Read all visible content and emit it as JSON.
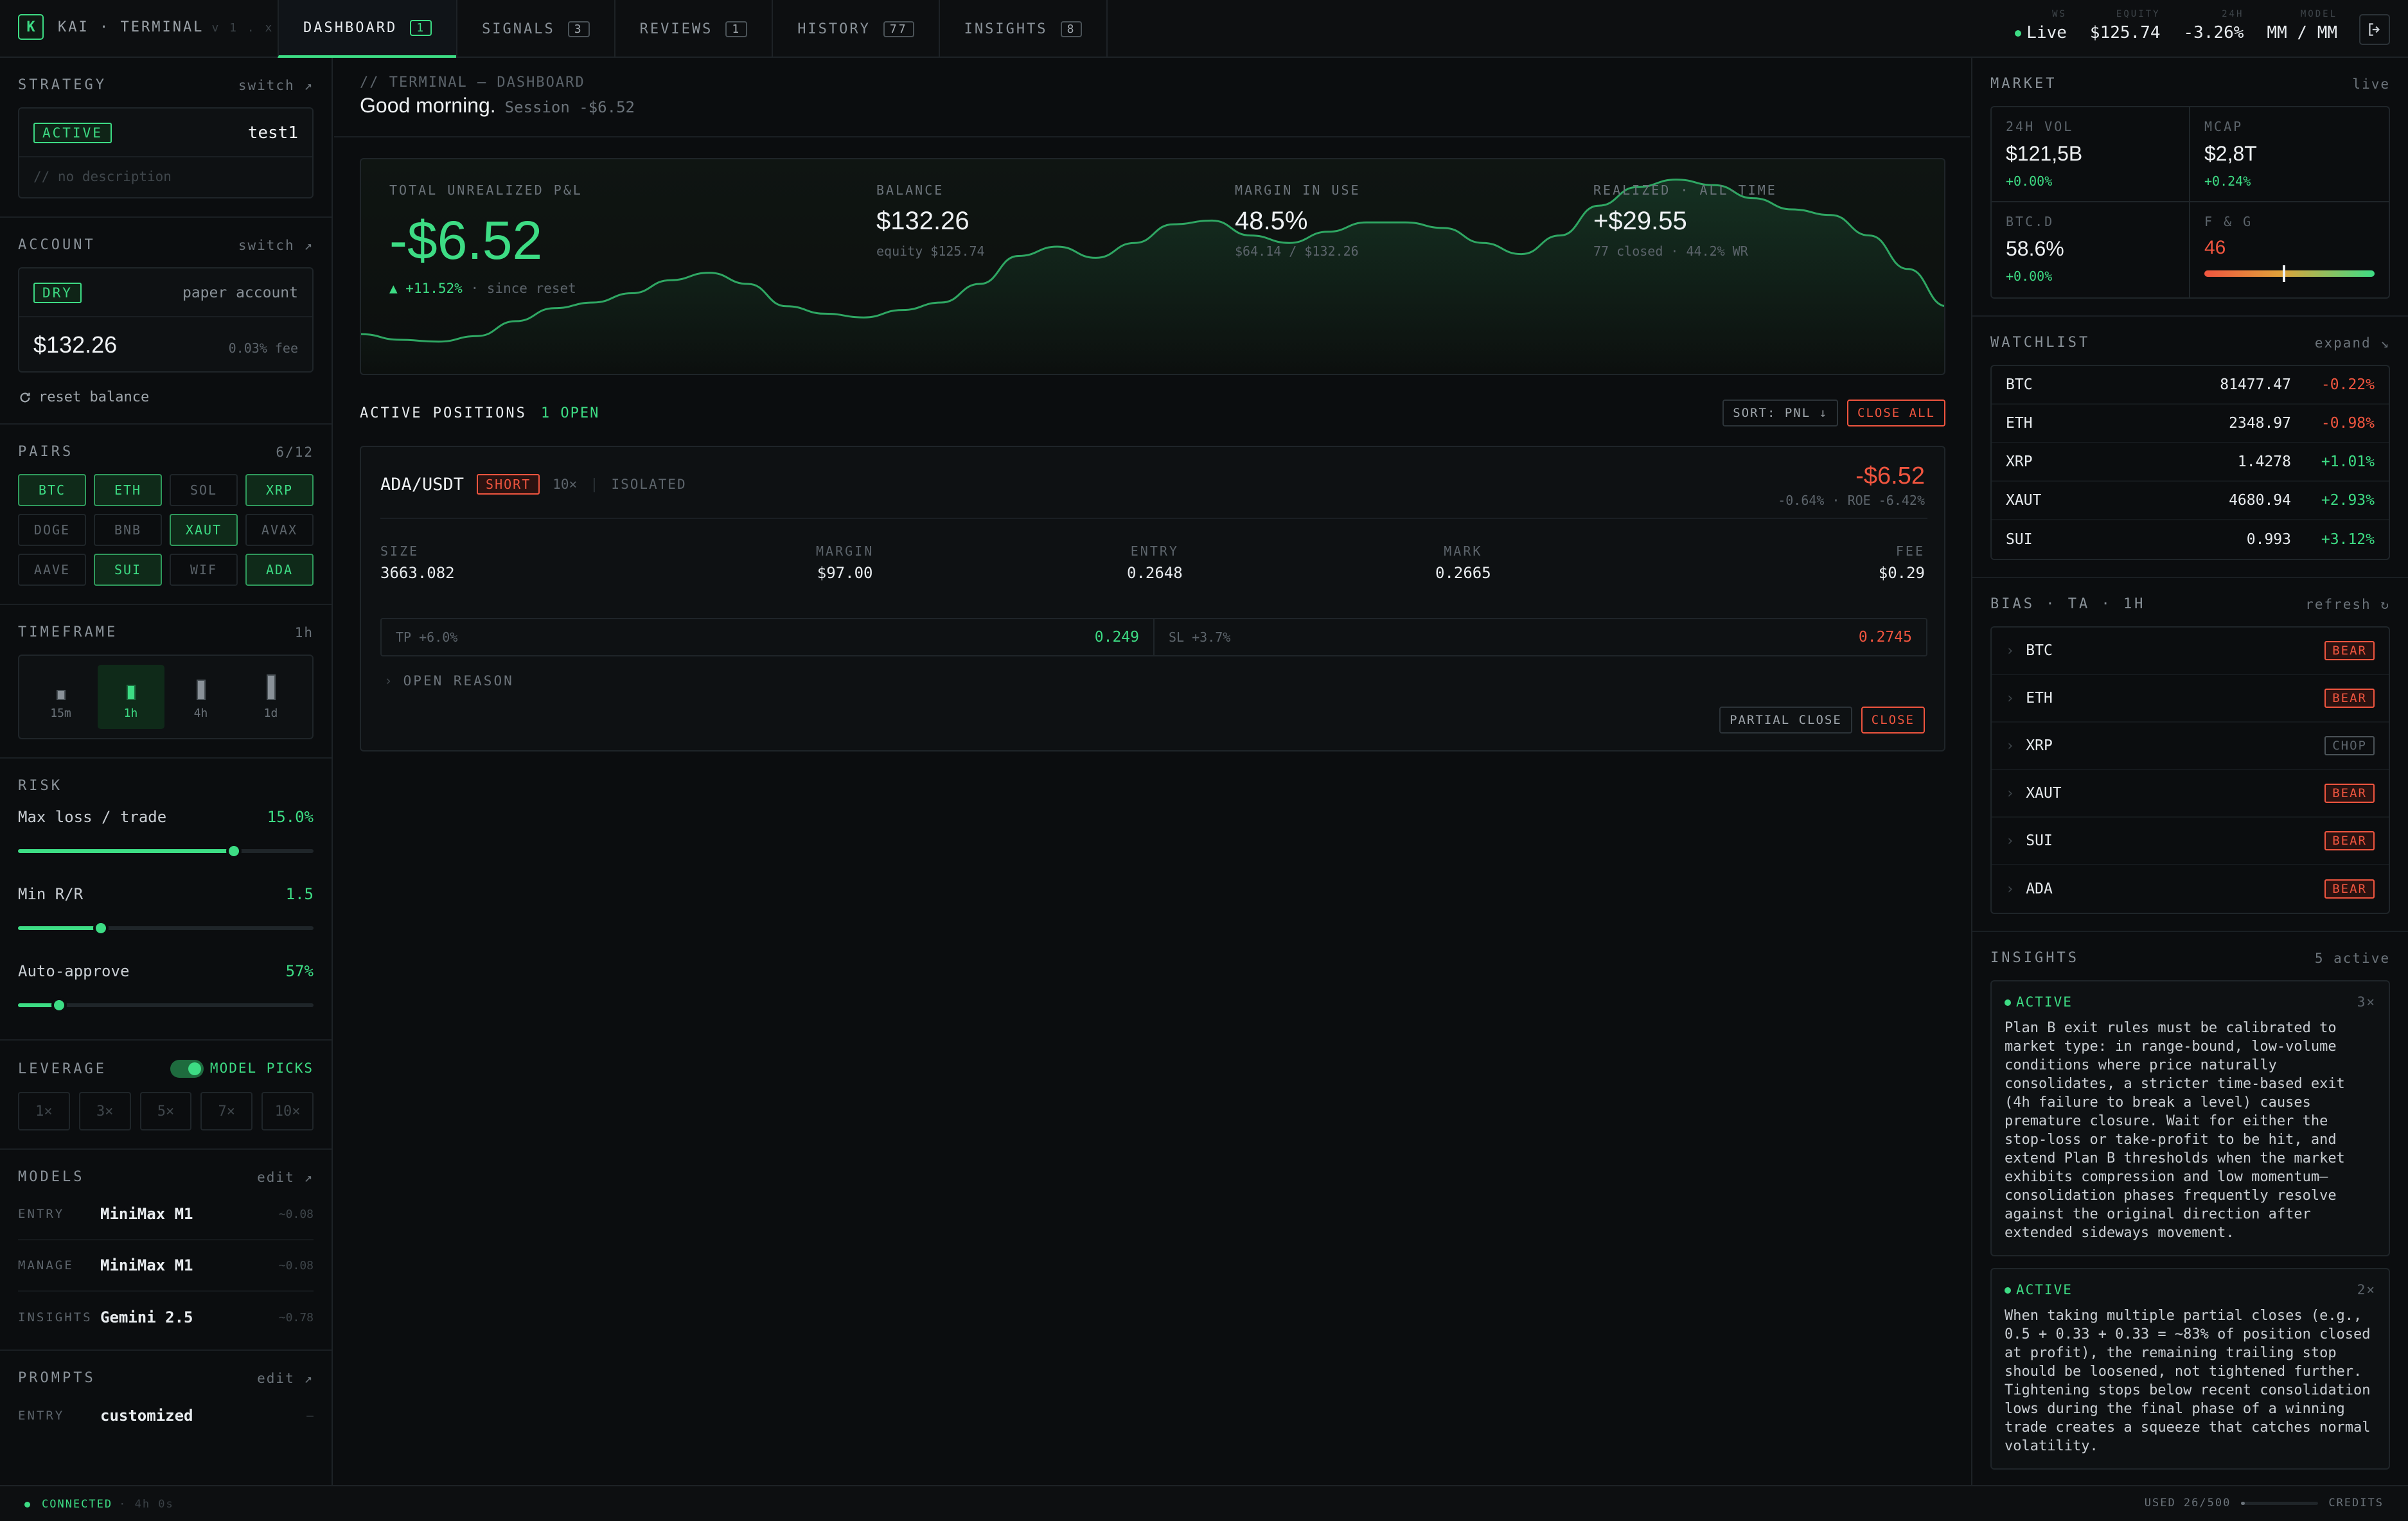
{
  "brand": {
    "logo": "K",
    "name": "KAI · TERMINAL",
    "version": "v 1 . x"
  },
  "tabs": [
    {
      "label": "DASHBOARD",
      "count": "1",
      "active": true
    },
    {
      "label": "SIGNALS",
      "count": "3"
    },
    {
      "label": "REVIEWS",
      "count": "1"
    },
    {
      "label": "HISTORY",
      "count": "77"
    },
    {
      "label": "INSIGHTS",
      "count": "8"
    }
  ],
  "topstats": {
    "ws_label": "WS",
    "ws_value": "Live",
    "equity_label": "EQUITY",
    "equity_value": "$125.74",
    "change_label": "24H",
    "change_value": "-3.26%",
    "model_label": "MODEL",
    "model_value": "MM / MM"
  },
  "strategy": {
    "title": "STRATEGY",
    "action": "switch ↗",
    "status": "ACTIVE",
    "name": "test1",
    "description": "// no description"
  },
  "account": {
    "title": "ACCOUNT",
    "action": "switch ↗",
    "mode": "DRY",
    "type": "paper account",
    "balance": "$132.26",
    "fee": "0.03% fee",
    "reset": "reset balance"
  },
  "pairs": {
    "title": "PAIRS",
    "count": "6/12",
    "items": [
      {
        "sym": "BTC",
        "on": true
      },
      {
        "sym": "ETH",
        "on": true
      },
      {
        "sym": "SOL",
        "on": false
      },
      {
        "sym": "XRP",
        "on": true
      },
      {
        "sym": "DOGE",
        "on": false
      },
      {
        "sym": "BNB",
        "on": false
      },
      {
        "sym": "XAUT",
        "on": true
      },
      {
        "sym": "AVAX",
        "on": false
      },
      {
        "sym": "AAVE",
        "on": false
      },
      {
        "sym": "SUI",
        "on": true
      },
      {
        "sym": "WIF",
        "on": false
      },
      {
        "sym": "ADA",
        "on": true
      }
    ]
  },
  "timeframe": {
    "title": "TIMEFRAME",
    "current": "1h",
    "options": [
      "15m",
      "1h",
      "4h",
      "1d"
    ],
    "selected": "1h"
  },
  "risk": {
    "title": "RISK",
    "rows": [
      {
        "label": "Max loss / trade",
        "value": "15.0%",
        "level": 0.73
      },
      {
        "label": "Min R/R",
        "value": "1.5",
        "level": 0.28
      },
      {
        "label": "Auto-approve",
        "value": "57%",
        "level": 0.14
      }
    ]
  },
  "leverage": {
    "title": "LEVERAGE",
    "toggle_label": "MODEL PICKS",
    "options": [
      "1×",
      "3×",
      "5×",
      "7×",
      "10×"
    ]
  },
  "models": {
    "title": "MODELS",
    "action": "edit ↗",
    "rows": [
      {
        "key": "ENTRY",
        "name": "MiniMax M1",
        "price": "~0.08"
      },
      {
        "key": "MANAGE",
        "name": "MiniMax M1",
        "price": "~0.08"
      },
      {
        "key": "INSIGHTS",
        "name": "Gemini 2.5",
        "price": "~0.78"
      }
    ]
  },
  "prompts": {
    "title": "PROMPTS",
    "action": "edit ↗",
    "rows": [
      {
        "key": "ENTRY",
        "value": "customized",
        "extra": "—"
      }
    ]
  },
  "main": {
    "crumb": "// TERMINAL — DASHBOARD",
    "greeting": "Good morning.",
    "session": "Session -$6.52"
  },
  "hero": {
    "pnl_label": "TOTAL UNREALIZED P&L",
    "pnl_value": "-$6.52",
    "pnl_change": "▲ +11.52%",
    "pnl_since": "· since reset",
    "balance_label": "BALANCE",
    "balance_value": "$132.26",
    "balance_sub": "equity $125.74",
    "margin_label": "MARGIN IN USE",
    "margin_value": "48.5%",
    "margin_sub": "$64.14 / $132.26",
    "realized_label": "REALIZED · ALL-TIME",
    "realized_value": "+$29.55",
    "realized_sub": "77 closed · 44.2% WR"
  },
  "equity_curve": [
    0.13,
    0.1,
    0.09,
    0.12,
    0.2,
    0.27,
    0.3,
    0.35,
    0.42,
    0.46,
    0.4,
    0.28,
    0.24,
    0.22,
    0.26,
    0.3,
    0.4,
    0.55,
    0.6,
    0.54,
    0.62,
    0.72,
    0.74,
    0.66,
    0.62,
    0.68,
    0.73,
    0.73,
    0.7,
    0.62,
    0.56,
    0.66,
    0.82,
    0.92,
    0.96,
    0.93,
    0.86,
    0.8,
    0.77,
    0.66,
    0.48,
    0.28
  ],
  "positions": {
    "title": "ACTIVE POSITIONS",
    "open": "1 OPEN",
    "sort": "SORT: PNL ↓",
    "close_all": "CLOSE ALL",
    "item": {
      "pair": "ADA/USDT",
      "side": "SHORT",
      "leverage": "10×",
      "margin_mode": "ISOLATED",
      "pnl": "-$6.52",
      "pnl_sub": "-0.64% · ROE -6.42%",
      "size_label": "SIZE",
      "size": "3663.082",
      "margin_label": "MARGIN",
      "margin": "$97.00",
      "entry_label": "ENTRY",
      "entry": "0.2648",
      "mark_label": "MARK",
      "mark": "0.2665",
      "fee_label": "FEE",
      "fee": "$0.29",
      "tp_label": "TP +6.0%",
      "tp": "0.249",
      "sl_label": "SL +3.7%",
      "sl": "0.2745",
      "reason": "OPEN REASON",
      "partial": "PARTIAL CLOSE",
      "close": "CLOSE"
    }
  },
  "market": {
    "title": "MARKET",
    "status": "live",
    "vol_label": "24H VOL",
    "vol": "$121,5B",
    "vol_change": "+0.00%",
    "mcap_label": "MCAP",
    "mcap": "$2,8T",
    "mcap_change": "+0.24%",
    "btcd_label": "BTC.D",
    "btcd": "58.6%",
    "btcd_change": "+0.00%",
    "fg_label": "F & G",
    "fg": "46",
    "fg_level": 0.46
  },
  "watchlist": {
    "title": "WATCHLIST",
    "action": "expand ↘",
    "rows": [
      {
        "sym": "BTC",
        "price": "81477.47",
        "change": "-0.22%",
        "dir": "down"
      },
      {
        "sym": "ETH",
        "price": "2348.97",
        "change": "-0.98%",
        "dir": "down"
      },
      {
        "sym": "XRP",
        "price": "1.4278",
        "change": "+1.01%",
        "dir": "up"
      },
      {
        "sym": "XAUT",
        "price": "4680.94",
        "change": "+2.93%",
        "dir": "up"
      },
      {
        "sym": "SUI",
        "price": "0.993",
        "change": "+3.12%",
        "dir": "up"
      }
    ]
  },
  "bias": {
    "title": "BIAS · TA · 1H",
    "action": "refresh",
    "rows": [
      {
        "sym": "BTC",
        "tag": "BEAR"
      },
      {
        "sym": "ETH",
        "tag": "BEAR"
      },
      {
        "sym": "XRP",
        "tag": "CHOP"
      },
      {
        "sym": "XAUT",
        "tag": "BEAR"
      },
      {
        "sym": "SUI",
        "tag": "BEAR"
      },
      {
        "sym": "ADA",
        "tag": "BEAR"
      }
    ]
  },
  "insights": {
    "title": "INSIGHTS",
    "count": "5 active",
    "items": [
      {
        "status": "ACTIVE",
        "mult": "3×",
        "text": "Plan B exit rules must be calibrated to market type: in range-bound, low-volume conditions where price naturally consolidates, a stricter time-based exit (4h failure to break a level) causes premature closure. Wait for either the stop-loss or take-profit to be hit, and extend Plan B thresholds when the market exhibits compression and low momentum—consolidation phases frequently resolve against the original direction after extended sideways movement."
      },
      {
        "status": "ACTIVE",
        "mult": "2×",
        "text": "When taking multiple partial closes (e.g., 0.5 + 0.33 + 0.33 = ~83% of position closed at profit), the remaining trailing stop should be loosened, not tightened further. Tightening stops below recent consolidation lows during the final phase of a winning trade creates a squeeze that catches normal volatility."
      }
    ]
  },
  "footer": {
    "status": "CONNECTED",
    "uptime": "· 4h 0s",
    "used": "USED 26/500",
    "credits": "CREDITS",
    "used_level": 0.05
  },
  "colors": {
    "accent": "#3ddc84",
    "danger": "#f0553f",
    "bg": "#0b0d0f"
  }
}
